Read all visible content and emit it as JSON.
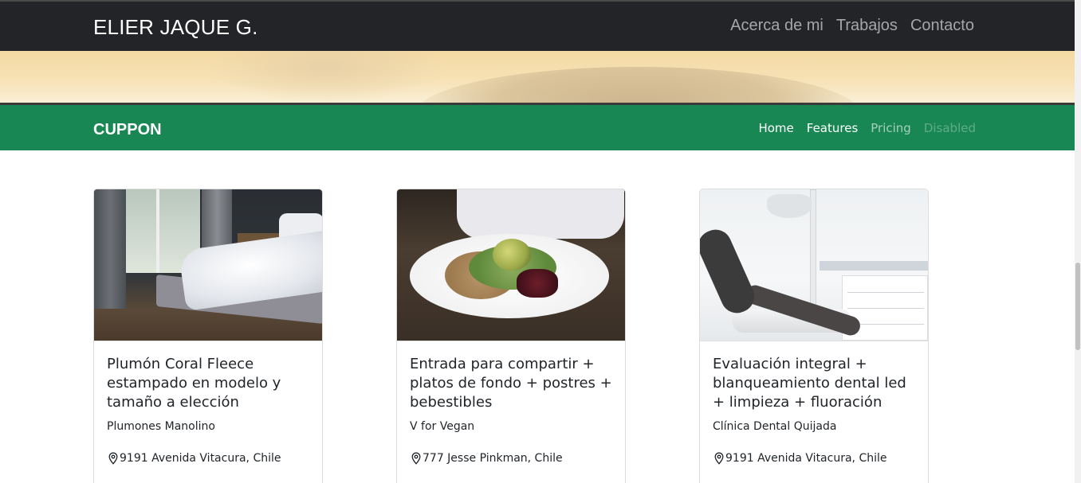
{
  "header": {
    "brand": "ELIER JAQUE G.",
    "nav": [
      "Acerca de mi",
      "Trabajos",
      "Contacto"
    ]
  },
  "navbar": {
    "brand": "CUPPON",
    "links": [
      {
        "label": "Home",
        "state": "active"
      },
      {
        "label": "Features",
        "state": "active"
      },
      {
        "label": "Pricing",
        "state": "muted"
      },
      {
        "label": "Disabled",
        "state": "disabled"
      }
    ]
  },
  "cards": [
    {
      "image": "bedroom-bed-photo",
      "title": "Plumón Coral Fleece estampado en modelo y tamaño a elección",
      "vendor": "Plumones Manolino",
      "location": "9191 Avenida Vitacura, Chile"
    },
    {
      "image": "vegan-food-plate-photo",
      "title": "Entrada para compartir + platos de fondo + postres + bebestibles",
      "vendor": "V for Vegan",
      "location": "777 Jesse Pinkman, Chile"
    },
    {
      "image": "dental-chair-photo",
      "title": "Evaluación integral + blanqueamiento dental led + limpieza + fluoración",
      "vendor": "Clínica Dental Quijada",
      "location": "9191 Avenida Vitacura, Chile"
    }
  ],
  "icons": {
    "location": "map-pin-icon"
  },
  "colors": {
    "topbar": "#222427",
    "navbar": "#198754",
    "text": "#212529"
  }
}
